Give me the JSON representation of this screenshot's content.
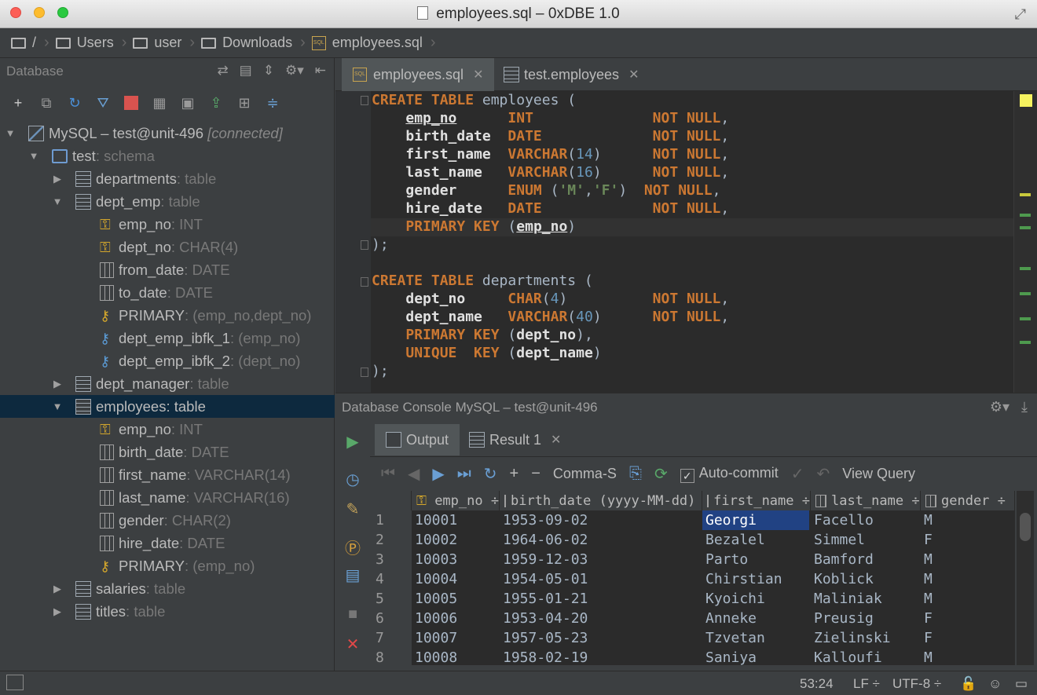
{
  "window": {
    "title": "employees.sql – 0xDBE 1.0"
  },
  "breadcrumb": [
    {
      "label": "/",
      "icon": "folder-icon"
    },
    {
      "label": "Users",
      "icon": "folder-icon"
    },
    {
      "label": "user",
      "icon": "folder-icon"
    },
    {
      "label": "Downloads",
      "icon": "folder-icon"
    },
    {
      "label": "employees.sql",
      "icon": "sql-file-icon"
    }
  ],
  "database_panel": {
    "title": "Database",
    "tree": [
      {
        "name": "MySQL – test@unit-496",
        "suffix": "[connected]",
        "type": "datasource",
        "expanded": true
      },
      {
        "name": "test",
        "suffix": ": schema",
        "type": "schema",
        "expanded": true
      },
      {
        "name": "departments",
        "suffix": ": table",
        "type": "table",
        "expanded": false
      },
      {
        "name": "dept_emp",
        "suffix": ": table",
        "type": "table",
        "expanded": true
      },
      {
        "name": "emp_no",
        "suffix": ": INT",
        "type": "pk-fk-column"
      },
      {
        "name": "dept_no",
        "suffix": ": CHAR(4)",
        "type": "pk-fk-column"
      },
      {
        "name": "from_date",
        "suffix": ": DATE",
        "type": "column"
      },
      {
        "name": "to_date",
        "suffix": ": DATE",
        "type": "column"
      },
      {
        "name": "PRIMARY",
        "suffix": ": (emp_no,dept_no)",
        "type": "primary-key"
      },
      {
        "name": "dept_emp_ibfk_1",
        "suffix": ": (emp_no)",
        "type": "foreign-key"
      },
      {
        "name": "dept_emp_ibfk_2",
        "suffix": ": (dept_no)",
        "type": "foreign-key"
      },
      {
        "name": "dept_manager",
        "suffix": ": table",
        "type": "table",
        "expanded": false
      },
      {
        "name": "employees: table",
        "suffix": "",
        "type": "table",
        "expanded": true,
        "selected": true
      },
      {
        "name": "emp_no",
        "suffix": ": INT",
        "type": "pk-column"
      },
      {
        "name": "birth_date",
        "suffix": ": DATE",
        "type": "column"
      },
      {
        "name": "first_name",
        "suffix": ": VARCHAR(14)",
        "type": "column"
      },
      {
        "name": "last_name",
        "suffix": ": VARCHAR(16)",
        "type": "column"
      },
      {
        "name": "gender",
        "suffix": ": CHAR(2)",
        "type": "column"
      },
      {
        "name": "hire_date",
        "suffix": ": DATE",
        "type": "column"
      },
      {
        "name": "PRIMARY",
        "suffix": ": (emp_no)",
        "type": "primary-key"
      },
      {
        "name": "salaries",
        "suffix": ": table",
        "type": "table",
        "expanded": false
      },
      {
        "name": "titles",
        "suffix": ": table",
        "type": "table",
        "expanded": false
      }
    ]
  },
  "editor_tabs": [
    {
      "label": "employees.sql",
      "active": true
    },
    {
      "label": "test.employees",
      "active": false
    }
  ],
  "console": {
    "title": "Database Console MySQL – test@unit-496",
    "tabs": [
      {
        "label": "Output"
      },
      {
        "label": "Result 1"
      }
    ],
    "toolbar": {
      "format": "Comma-S",
      "autocommit": "Auto-commit",
      "view_query": "View Query"
    },
    "columns": [
      "emp_no",
      "birth_date (yyyy-MM-dd)",
      "first_name",
      "last_name",
      "gender"
    ],
    "rows": [
      [
        "1",
        "10001",
        "1953-09-02",
        "Georgi",
        "Facello",
        "M"
      ],
      [
        "2",
        "10002",
        "1964-06-02",
        "Bezalel",
        "Simmel",
        "F"
      ],
      [
        "3",
        "10003",
        "1959-12-03",
        "Parto",
        "Bamford",
        "M"
      ],
      [
        "4",
        "10004",
        "1954-05-01",
        "Chirstian",
        "Koblick",
        "M"
      ],
      [
        "5",
        "10005",
        "1955-01-21",
        "Kyoichi",
        "Maliniak",
        "M"
      ],
      [
        "6",
        "10006",
        "1953-04-20",
        "Anneke",
        "Preusig",
        "F"
      ],
      [
        "7",
        "10007",
        "1957-05-23",
        "Tzvetan",
        "Zielinski",
        "F"
      ],
      [
        "8",
        "10008",
        "1958-02-19",
        "Saniya",
        "Kalloufi",
        "M"
      ]
    ]
  },
  "statusbar": {
    "position": "53:24",
    "line_sep": "LF ÷",
    "encoding": "UTF-8 ÷"
  },
  "colors": {
    "keyword": "#cc7832",
    "number": "#6897bb",
    "string": "#6a8759",
    "selection": "#0d293e"
  }
}
